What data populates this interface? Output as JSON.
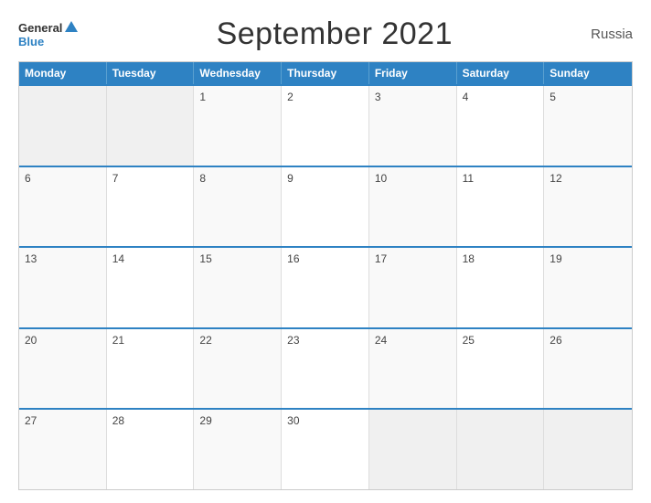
{
  "header": {
    "logo_general": "General",
    "logo_blue": "Blue",
    "title": "September 2021",
    "country": "Russia"
  },
  "calendar": {
    "days_of_week": [
      "Monday",
      "Tuesday",
      "Wednesday",
      "Thursday",
      "Friday",
      "Saturday",
      "Sunday"
    ],
    "weeks": [
      [
        {
          "day": "",
          "empty": true
        },
        {
          "day": "",
          "empty": true
        },
        {
          "day": "1"
        },
        {
          "day": "2"
        },
        {
          "day": "3"
        },
        {
          "day": "4"
        },
        {
          "day": "5"
        }
      ],
      [
        {
          "day": "6"
        },
        {
          "day": "7"
        },
        {
          "day": "8"
        },
        {
          "day": "9"
        },
        {
          "day": "10"
        },
        {
          "day": "11"
        },
        {
          "day": "12"
        }
      ],
      [
        {
          "day": "13"
        },
        {
          "day": "14"
        },
        {
          "day": "15"
        },
        {
          "day": "16"
        },
        {
          "day": "17"
        },
        {
          "day": "18"
        },
        {
          "day": "19"
        }
      ],
      [
        {
          "day": "20"
        },
        {
          "day": "21"
        },
        {
          "day": "22"
        },
        {
          "day": "23"
        },
        {
          "day": "24"
        },
        {
          "day": "25"
        },
        {
          "day": "26"
        }
      ],
      [
        {
          "day": "27"
        },
        {
          "day": "28"
        },
        {
          "day": "29"
        },
        {
          "day": "30"
        },
        {
          "day": "",
          "empty": true
        },
        {
          "day": "",
          "empty": true
        },
        {
          "day": "",
          "empty": true
        }
      ]
    ]
  }
}
